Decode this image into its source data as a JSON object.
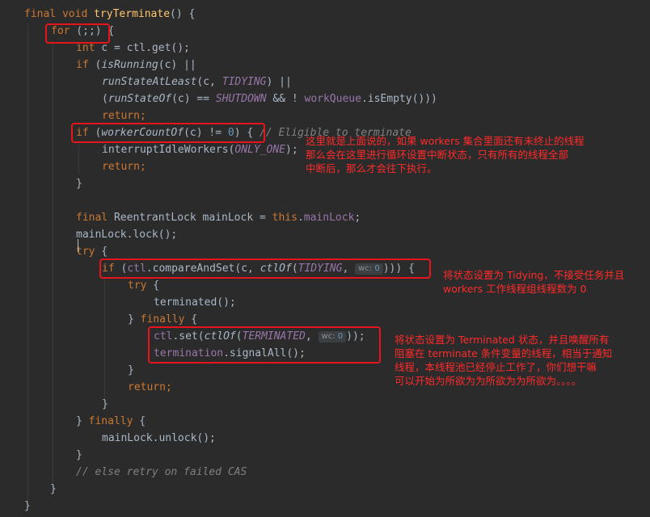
{
  "code": {
    "l1": {
      "kw1": "final",
      "kw2": "void",
      "fn": "tryTerminate",
      "rest": "() {"
    },
    "l2": {
      "kw": "for",
      "rest": " (;;) {"
    },
    "l3": {
      "kw": "int",
      "pre": " c = ctl.get();"
    },
    "l4": {
      "kw": "if",
      "pre": " (",
      "fn": "isRunning",
      "post": "(c) ||"
    },
    "l5": {
      "fn": "runStateAtLeast",
      "pre": "(c, ",
      "field": "TIDYING",
      "post": ") ||"
    },
    "l6": {
      "pre": "(",
      "fn": "runStateOf",
      "mid": "(c) == ",
      "field": "SHUTDOWN",
      "post": " && ! ",
      "field2": "workQueue",
      "post2": ".isEmpty()))"
    },
    "l7": {
      "kw": "return",
      "post": ";"
    },
    "l8": {
      "kw": "if",
      "pre": " (",
      "fn": "workerCountOf",
      "mid": "(c) != ",
      "num": "0",
      "post": ") { ",
      "comment": "// Eligible to terminate"
    },
    "l9": {
      "pre": "interruptIdleWorkers(",
      "field": "ONLY_ONE",
      "post": ");"
    },
    "l10": {
      "kw": "return",
      "post": ";"
    },
    "l11": {
      "text": "}"
    },
    "l12": {
      "kw": "final",
      "pre": " ReentrantLock mainLock = ",
      "kw2": "this",
      "dot": ".",
      "field": "mainLock",
      "post": ";"
    },
    "l13": {
      "text": "mainLock.lock();"
    },
    "l14": {
      "kw": "try",
      "post": " {"
    },
    "l15": {
      "kw": "if",
      "pre": " (",
      "field": "ctl",
      "mid": ".compareAndSet(c, ",
      "fn": "ctlOf",
      "open": "(",
      "field2": "TIDYING",
      "comma": ", ",
      "hint": "wc:",
      "num": "0",
      "post": "))) {"
    },
    "l16": {
      "kw": "try",
      "post": " {"
    },
    "l17": {
      "text": "terminated();"
    },
    "l18": {
      "pre": "} ",
      "kw": "finally",
      "post": " {"
    },
    "l19": {
      "field": "ctl",
      "mid": ".set(",
      "fn": "ctlOf",
      "open": "(",
      "field2": "TERMINATED",
      "comma": ", ",
      "hint": "wc:",
      "num": "0",
      "post": "));"
    },
    "l20": {
      "field": "termination",
      "post": ".signalAll();"
    },
    "l21": {
      "text": "}"
    },
    "l22": {
      "kw": "return",
      "post": ";"
    },
    "l23": {
      "text": "}"
    },
    "l24": {
      "pre": "} ",
      "kw": "finally",
      "post": " {"
    },
    "l25": {
      "text": "mainLock.unlock();"
    },
    "l26": {
      "text": "}"
    },
    "l27": {
      "comment": "// else retry on failed CAS"
    },
    "l28": {
      "text": "}"
    },
    "l29": {
      "text": "}"
    }
  },
  "annotations": {
    "workers_note": "这里就是上面说的，如果 workers 集合里面还有未终止的线程\n那么会在这里进行循环设置中断状态，只有所有的线程全部\n中断后，那么才会往下执行。",
    "tidying_note": "将状态设置为 Tidying，不接受任务并且\nworkers 工作线程组线程数为 0",
    "terminated_note": "将状态设置为 Terminated 状态，并且唤醒所有\n阻塞在 terminate 条件变量的线程，相当于通知\n线程，本线程池已经停止工作了，你们想干嘛\n可以开始为所欲为为所欲为为所欲为。。。。"
  },
  "colors": {
    "background": "#2b2b2b",
    "keyword": "#cc7832",
    "method": "#ffc66d",
    "field": "#9876aa",
    "number": "#6897bb",
    "comment": "#808080",
    "annotation_red": "#ff2a2a"
  }
}
